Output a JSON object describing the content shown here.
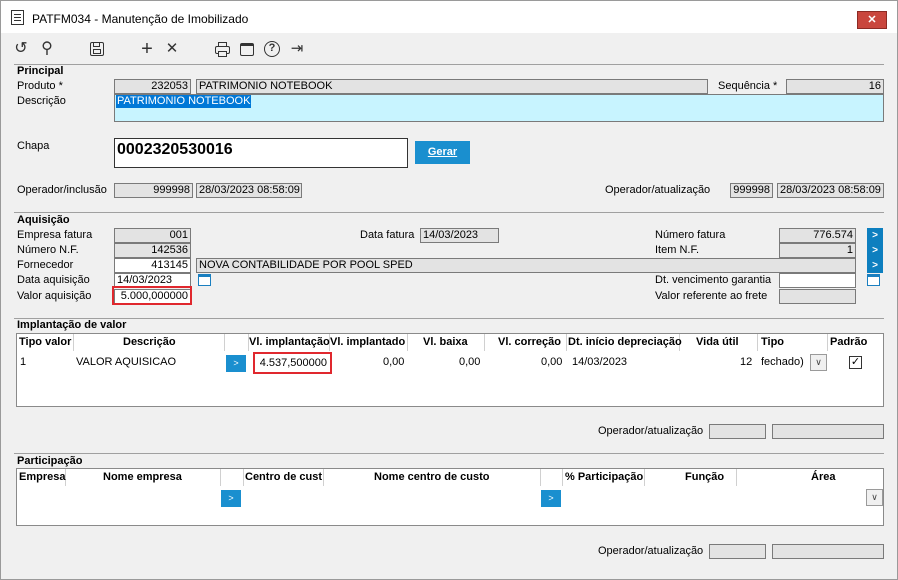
{
  "window": {
    "title": "PATFM034 - Manutenção de Imobilizado",
    "close_symbol": "✕"
  },
  "toolbar": {
    "undo": "↺",
    "search": "⚲",
    "save": "💾",
    "add": "+",
    "delete": "✕",
    "print": "🖶",
    "calendar": "▦",
    "help": "?",
    "exit": "⇥"
  },
  "principal": {
    "section": "Principal",
    "produto_label": "Produto *",
    "produto_code": "232053",
    "produto_name": "PATRIMONIO NOTEBOOK",
    "sequencia_label": "Sequência *",
    "sequencia_value": "16",
    "descricao_label": "Descrição",
    "descricao_value": "PATRIMONIO NOTEBOOK",
    "chapa_label": "Chapa",
    "chapa_value": "0002320530016",
    "gerar_label": "Gerar",
    "operador_inclusao_label": "Operador/inclusão",
    "operador_inclusao_id": "999998",
    "operador_inclusao_date": "28/03/2023 08:58:09",
    "operador_atualizacao_label": "Operador/atualização",
    "operador_atualizacao_id": "999998",
    "operador_atualizacao_date": "28/03/2023 08:58:09"
  },
  "aquisicao": {
    "section": "Aquisição",
    "empresa_fatura_label": "Empresa fatura",
    "empresa_fatura_value": "001",
    "data_fatura_label": "Data fatura",
    "data_fatura_value": "14/03/2023",
    "numero_fatura_label": "Número fatura",
    "numero_fatura_value": "776.574",
    "numero_nf_label": "Número N.F.",
    "numero_nf_value": "142536",
    "item_nf_label": "Item N.F.",
    "item_nf_value": "1",
    "fornecedor_label": "Fornecedor",
    "fornecedor_code": "413145",
    "fornecedor_name": "NOVA CONTABILIDADE POR POOL SPED",
    "data_aquisicao_label": "Data aquisição",
    "data_aquisicao_value": "14/03/2023",
    "dt_venc_garantia_label": "Dt. vencimento garantia",
    "dt_venc_garantia_value": "",
    "valor_aquisicao_label": "Valor aquisição",
    "valor_aquisicao_value": "5.000,000000",
    "valor_frete_label": "Valor referente ao frete",
    "valor_frete_value": ""
  },
  "implantacao": {
    "section": "Implantação de valor",
    "headers": [
      "Tipo valor",
      "Descrição",
      "Vl. implantação",
      "Vl. implantado",
      "Vl. baixa",
      "Vl. correção",
      "Dt. início depreciação",
      "Vida útil",
      "Tipo",
      "Padrão"
    ],
    "row": {
      "tipo_valor": "1",
      "descricao": "VALOR AQUISICAO",
      "btn": ">",
      "vl_implantacao": "4.537,500000",
      "vl_implantado": "0,00",
      "vl_baixa": "0,00",
      "vl_correcao": "0,00",
      "dt_inicio": "14/03/2023",
      "vida_util": "12",
      "tipo": "fechado)",
      "padrao_check": "✓"
    },
    "operador_label": "Operador/atualização"
  },
  "participacao": {
    "section": "Participação",
    "headers": [
      "Empresa",
      "Nome empresa",
      "Centro de custo",
      "Nome centro de custo",
      "% Participação",
      "Função",
      "Área"
    ],
    "btn": ">",
    "operador_label": "Operador/atualização"
  },
  "colors": {
    "accent": "#0d7fbf",
    "highlight": "#c8f4ff",
    "selection": "#0078d7",
    "annotation": "#e0282e"
  }
}
